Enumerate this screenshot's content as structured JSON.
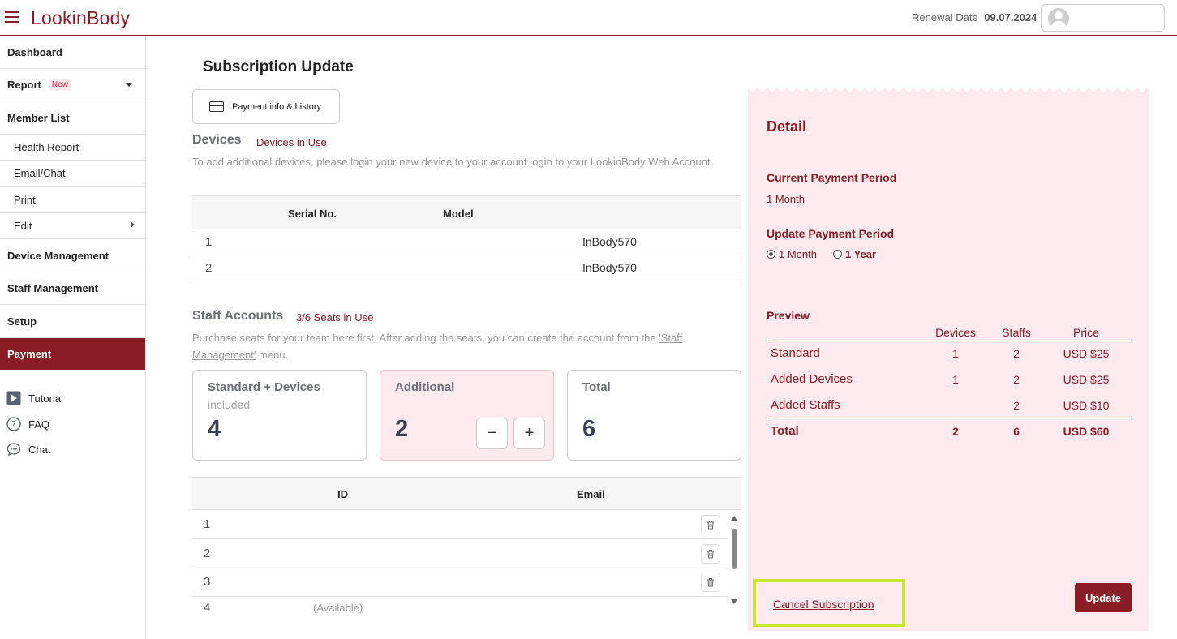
{
  "header": {
    "logo": "LookinBody",
    "renewal_label": "Renewal Date",
    "renewal_date": "09.07.2024"
  },
  "sidebar": {
    "items": [
      {
        "label": "Dashboard"
      },
      {
        "label": "Report",
        "badge": "New"
      },
      {
        "label": "Member List"
      },
      {
        "label": "Health Report"
      },
      {
        "label": "Email/Chat"
      },
      {
        "label": "Print"
      },
      {
        "label": "Edit"
      },
      {
        "label": "Device Management"
      },
      {
        "label": "Staff Management"
      },
      {
        "label": "Setup"
      },
      {
        "label": "Payment"
      }
    ],
    "help": [
      {
        "label": "Tutorial",
        "icon": "play-icon"
      },
      {
        "label": "FAQ",
        "icon": "question-icon"
      },
      {
        "label": "Chat",
        "icon": "chat-bubble-icon"
      }
    ]
  },
  "main": {
    "title": "Subscription Update",
    "payment_info_button": "Payment info & history",
    "devices": {
      "title": "Devices",
      "status": "Devices in Use",
      "description": "To add additional devices, please login your new device to your account login to your LookinBody Web Account.",
      "columns": [
        "Serial No.",
        "Model"
      ],
      "rows": [
        {
          "index": "1",
          "model": "InBody570"
        },
        {
          "index": "2",
          "model": "InBody570"
        }
      ]
    },
    "staff": {
      "title": "Staff Accounts",
      "status": "3/6 Seats in Use",
      "description_pre": "Purchase seats for your team here first. After adding the seats, you can create the account from the ",
      "description_link": "'Staff Management'",
      "description_post": " menu.",
      "cards": {
        "standard": {
          "label": "Standard + Devices",
          "sub": "included",
          "value": "4"
        },
        "additional": {
          "label": "Additional",
          "value": "2",
          "minus": "−",
          "plus": "+"
        },
        "total": {
          "label": "Total",
          "value": "6"
        }
      },
      "columns": [
        "ID",
        "Email"
      ],
      "rows": [
        {
          "index": "1",
          "email": ""
        },
        {
          "index": "2",
          "email": ""
        },
        {
          "index": "3",
          "email": ""
        },
        {
          "index": "4",
          "email": "(Available)"
        }
      ]
    }
  },
  "detail": {
    "title": "Detail",
    "current_period_label": "Current Payment Period",
    "current_period_value": "1 Month",
    "update_period_label": "Update Payment Period",
    "options": [
      "1 Month",
      "1 Year"
    ],
    "selected_option": "1 Month",
    "preview_label": "Preview",
    "preview_columns": [
      "Devices",
      "Staffs",
      "Price"
    ],
    "preview_rows": [
      {
        "name": "Standard",
        "devices": "1",
        "staffs": "2",
        "price": "USD $25"
      },
      {
        "name": "Added Devices",
        "devices": "1",
        "staffs": "2",
        "price": "USD $25"
      },
      {
        "name": "Added Staffs",
        "devices": "",
        "staffs": "2",
        "price": "USD $10"
      }
    ],
    "total_row": {
      "name": "Total",
      "devices": "2",
      "staffs": "6",
      "price": "USD $60"
    },
    "cancel_link": "Cancel Subscription",
    "update_button": "Update"
  },
  "colors": {
    "brand": "#8a1c26",
    "panel_bg": "#fdeaee",
    "highlight": "#c8e62c"
  }
}
